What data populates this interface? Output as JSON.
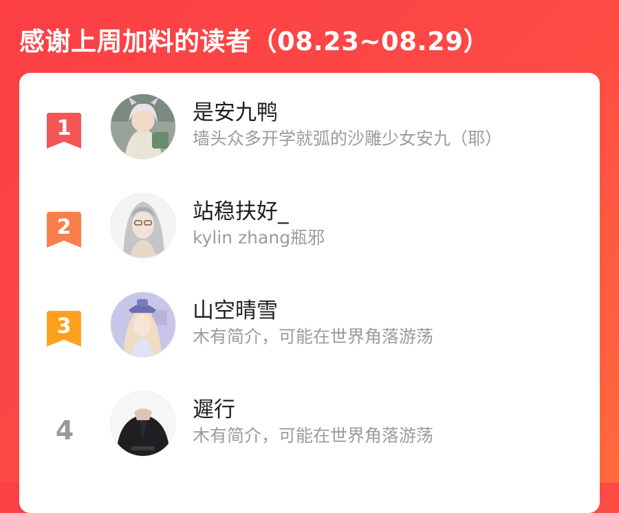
{
  "header": {
    "title": "感谢上周加料的读者（08.23~08.29）"
  },
  "colors": {
    "background": "#fb4046",
    "rank1": "#f35657",
    "rank2": "#fa7e4c",
    "rank3": "#ffa11f",
    "rank_plain": "#9a9a9a"
  },
  "readers": [
    {
      "rank": "1",
      "name": "是安九鸭",
      "bio": "墙头众多开学就弧的沙雕少女安九（耶）",
      "badge_icon": "ribbon-bookmark-icon"
    },
    {
      "rank": "2",
      "name": "站稳扶好_",
      "bio": "kylin zhang瓶邪",
      "badge_icon": "ribbon-bookmark-icon"
    },
    {
      "rank": "3",
      "name": "山空晴雪",
      "bio": "木有简介，可能在世界角落游荡",
      "badge_icon": "ribbon-bookmark-icon"
    },
    {
      "rank": "4",
      "name": "遲行",
      "bio": "木有简介，可能在世界角落游荡"
    }
  ]
}
